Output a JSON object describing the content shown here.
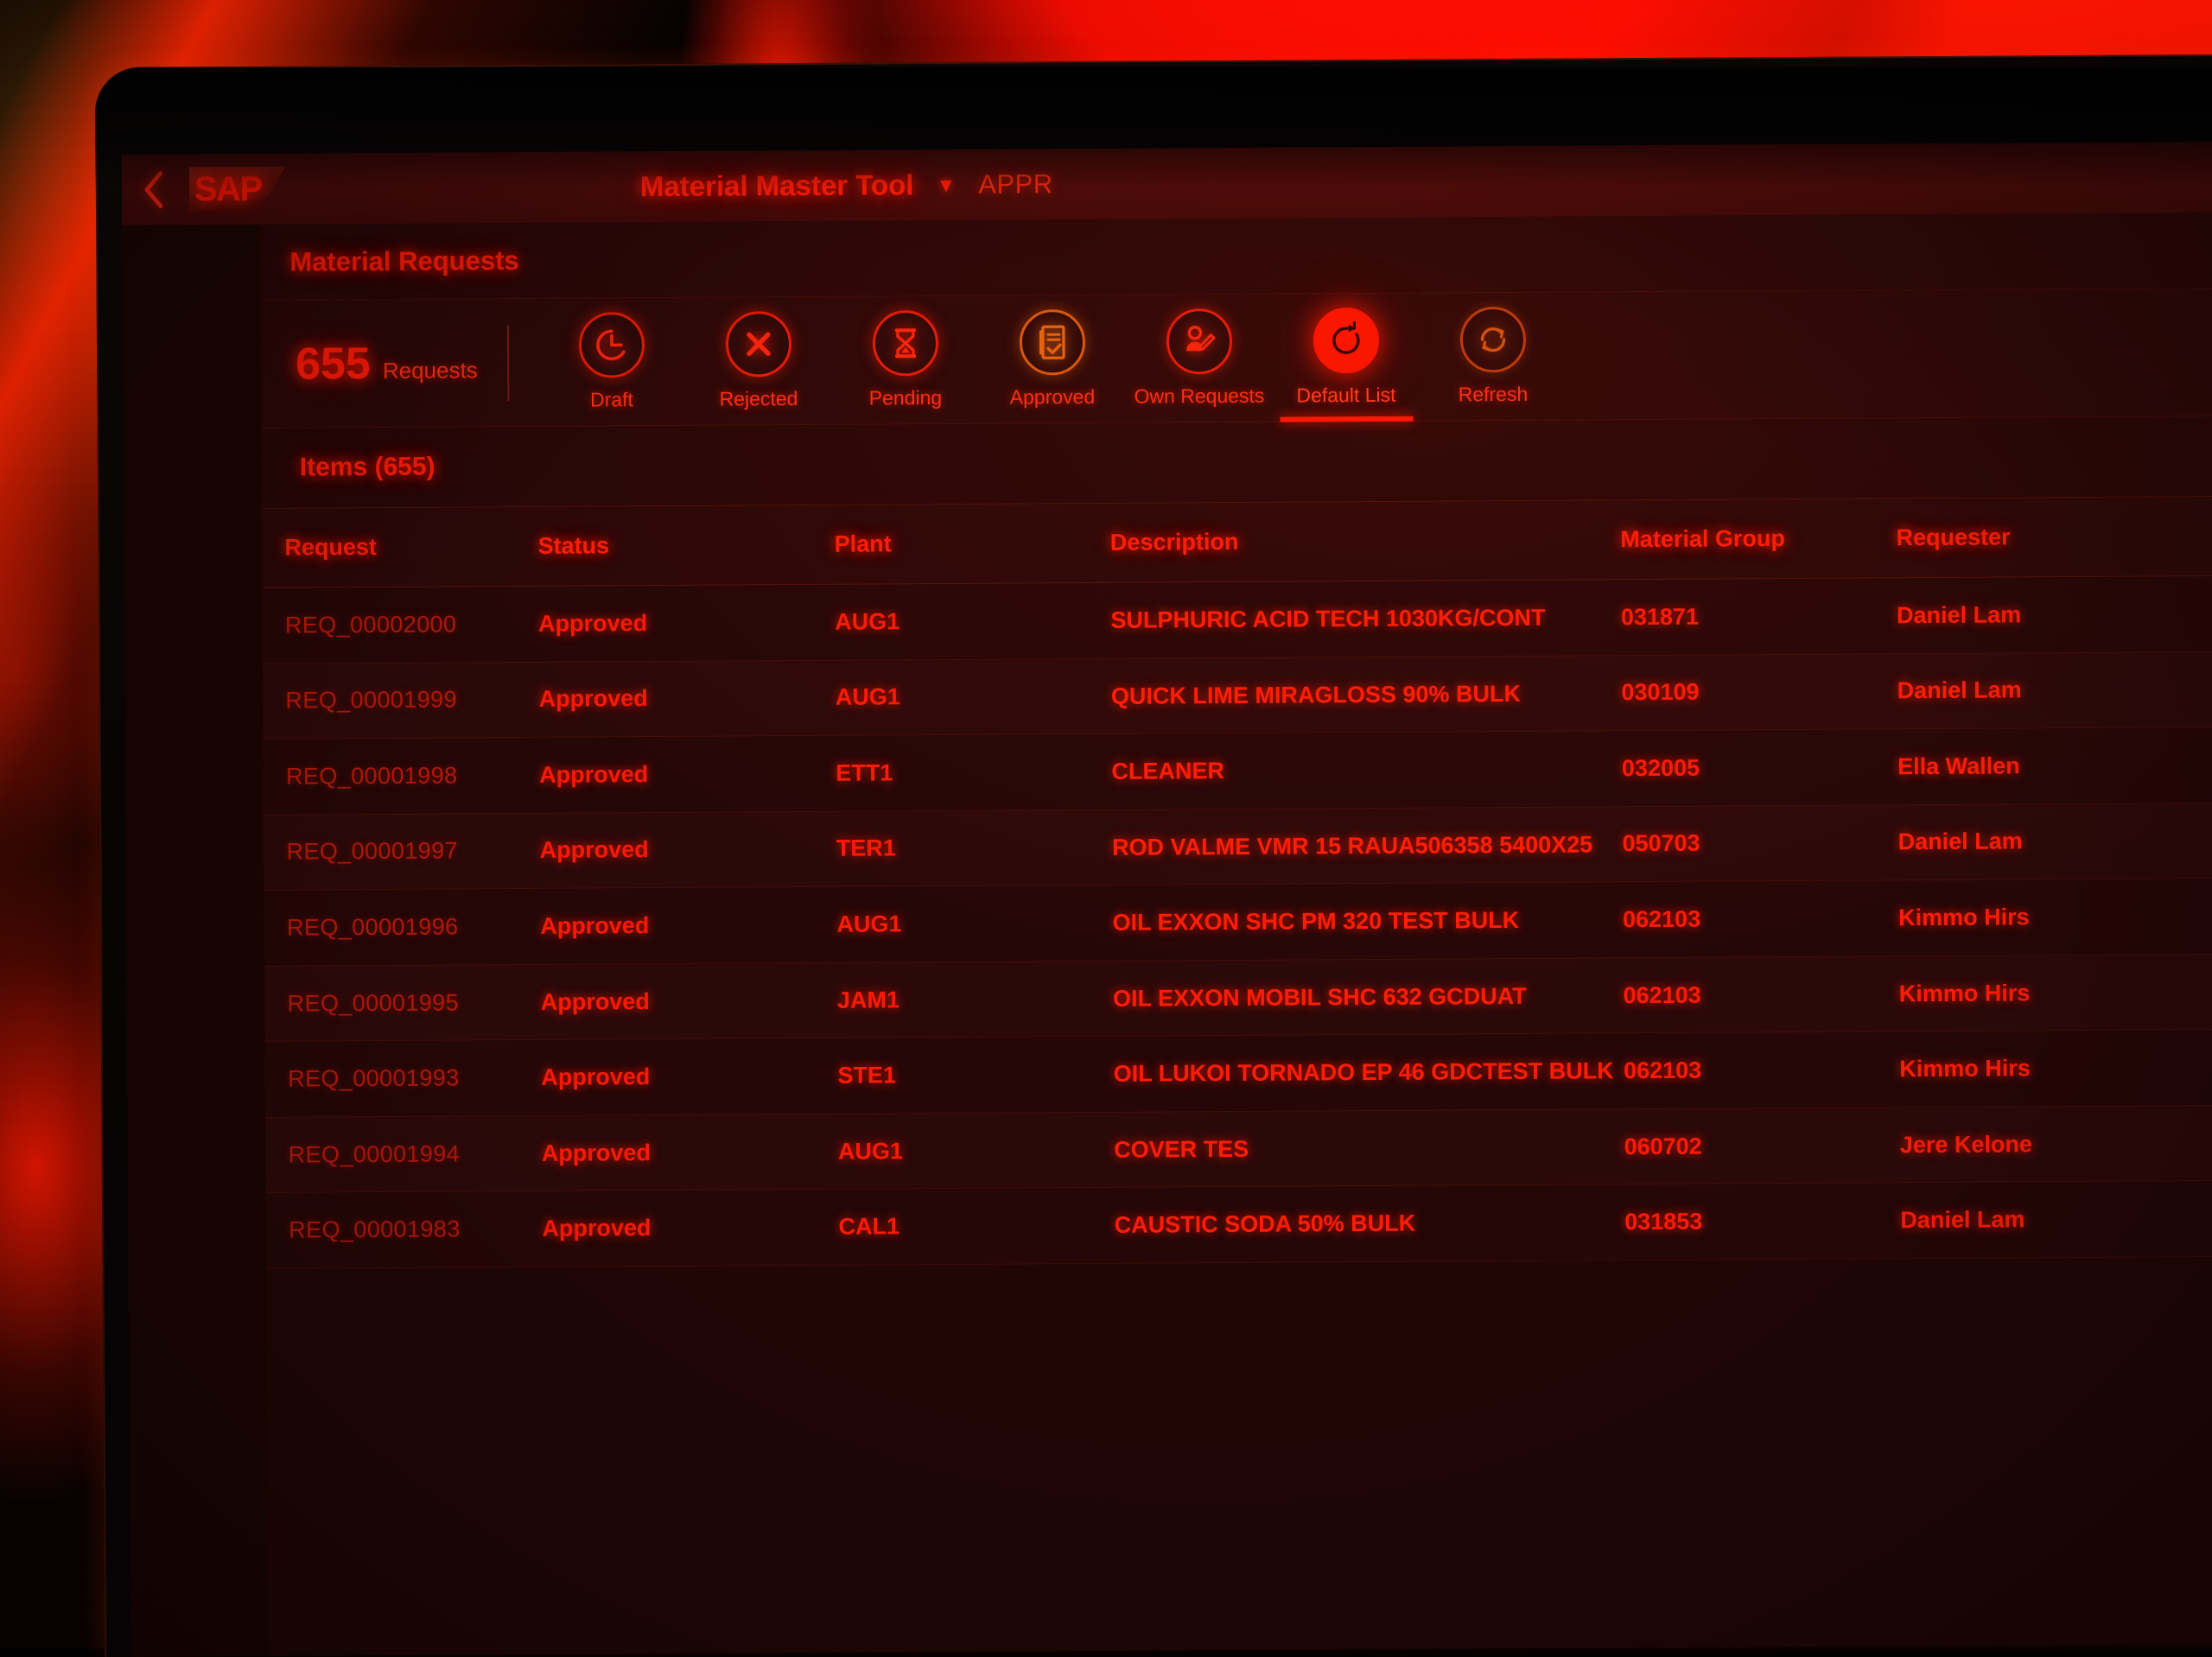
{
  "shell": {
    "back_icon": "chevron-left-icon",
    "logo_text": "SAP",
    "app_title": "Material Master Tool",
    "app_title_caret": "▼",
    "app_subtitle": "APPR"
  },
  "page": {
    "title": "Material Requests"
  },
  "kpi": {
    "value": "655",
    "label": "Requests"
  },
  "tabs": [
    {
      "label": "Draft",
      "icon": "clock-icon",
      "selected": false,
      "accent": "#e31a06"
    },
    {
      "label": "Rejected",
      "icon": "x-circle-icon",
      "selected": false,
      "accent": "#e31a06"
    },
    {
      "label": "Pending",
      "icon": "hourglass-icon",
      "selected": false,
      "accent": "#e31a06"
    },
    {
      "label": "Approved",
      "icon": "document-check-icon",
      "selected": false,
      "accent": "#d8560a"
    },
    {
      "label": "Own Requests",
      "icon": "user-edit-icon",
      "selected": false,
      "accent": "#e31a06"
    },
    {
      "label": "Default List",
      "icon": "refresh-arrow-icon",
      "selected": true,
      "accent": "#fb1300"
    },
    {
      "label": "Refresh",
      "icon": "sync-icon",
      "selected": false,
      "accent": "#b8380a"
    }
  ],
  "items": {
    "title": "Items (655)",
    "columns": [
      "Request",
      "Status",
      "Plant",
      "Description",
      "Material Group",
      "Requester"
    ],
    "rows": [
      {
        "request": "REQ_00002000",
        "status": "Approved",
        "plant": "AUG1",
        "description": "SULPHURIC ACID TECH 1030KG/CONT",
        "material_group": "031871",
        "requester": "Daniel Lam"
      },
      {
        "request": "REQ_00001999",
        "status": "Approved",
        "plant": "AUG1",
        "description": "QUICK LIME MIRAGLOSS 90% BULK",
        "material_group": "030109",
        "requester": "Daniel Lam"
      },
      {
        "request": "REQ_00001998",
        "status": "Approved",
        "plant": "ETT1",
        "description": "CLEANER",
        "material_group": "032005",
        "requester": "Ella Wallen"
      },
      {
        "request": "REQ_00001997",
        "status": "Approved",
        "plant": "TER1",
        "description": "ROD VALME VMR 15 RAUA506358 5400X25",
        "material_group": "050703",
        "requester": "Daniel Lam"
      },
      {
        "request": "REQ_00001996",
        "status": "Approved",
        "plant": "AUG1",
        "description": "OIL EXXON SHC PM 320 TEST BULK",
        "material_group": "062103",
        "requester": "Kimmo Hirs"
      },
      {
        "request": "REQ_00001995",
        "status": "Approved",
        "plant": "JAM1",
        "description": "OIL EXXON MOBIL SHC 632 GCDUAT",
        "material_group": "062103",
        "requester": "Kimmo Hirs"
      },
      {
        "request": "REQ_00001993",
        "status": "Approved",
        "plant": "STE1",
        "description": "OIL LUKOI TORNADO EP 46 GDCTEST BULK",
        "material_group": "062103",
        "requester": "Kimmo Hirs"
      },
      {
        "request": "REQ_00001994",
        "status": "Approved",
        "plant": "AUG1",
        "description": "COVER TES",
        "material_group": "060702",
        "requester": "Jere Kelone"
      },
      {
        "request": "REQ_00001983",
        "status": "Approved",
        "plant": "CAL1",
        "description": "CAUSTIC SODA 50% BULK",
        "material_group": "031853",
        "requester": "Daniel Lam"
      }
    ]
  },
  "colors": {
    "brand_red": "#ff1504",
    "shell_bg": "#470a09",
    "content_bg": "#280707",
    "selected_tab": "#fb1300",
    "approved_icon": "#d8560a"
  }
}
